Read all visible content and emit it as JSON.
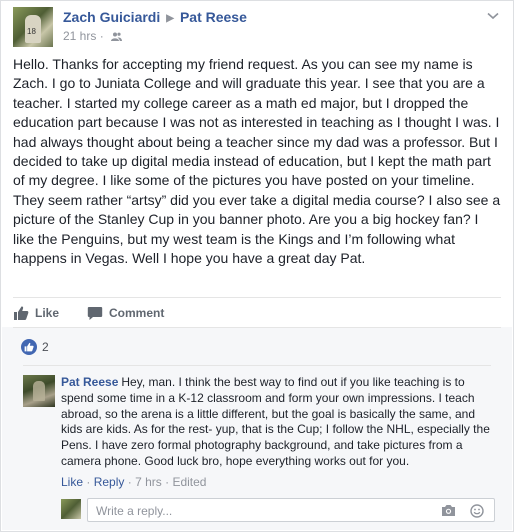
{
  "post": {
    "author": "Zach Guiciardi",
    "recipient": "Pat Reese",
    "timestamp": "21 hrs",
    "audience_icon": "friends-icon",
    "menu_icon": "chevron-down-icon",
    "body": "Hello. Thanks for accepting my friend request. As you can see my name is Zach. I go to Juniata College and will graduate this year. I see that you are a teacher. I started my college career as a math ed major, but I dropped the education part because I was not as interested in teaching as I thought I was. I had always thought about being a teacher since my dad was a professor. But I decided to take up digital media instead of education, but I kept the math part of my degree. I like some of the pictures you have posted on your timeline. They seem rather “artsy” did you ever take a digital media course? I also see a picture of the Stanley Cup in you banner photo. Are you a big hockey fan? I like the Penguins, but my west team is the Kings and I’m following what happens in Vegas. Well I hope you have a great day Pat."
  },
  "actions": {
    "like": "Like",
    "comment": "Comment"
  },
  "reactions": {
    "count": "2"
  },
  "comment": {
    "author": "Pat Reese",
    "text": "Hey, man. I think the best way to find out if you like teaching is to spend some time in a K-12 classroom and form your own impressions. I teach abroad, so the arena is a little different, but the goal is basically the same, and kids are kids. As for the rest- yup, that is the Cup; I follow the NHL, especially the Pens. I have zero formal photography background, and take pictures from a camera phone. Good luck bro, hope everything works out for you.",
    "like": "Like",
    "reply": "Reply",
    "time": "7 hrs",
    "edited": "Edited",
    "sep": "·"
  },
  "reply_box": {
    "placeholder": "Write a reply..."
  },
  "colors": {
    "link": "#365899",
    "muted": "#90949c",
    "like_blue": "#4267b2"
  }
}
